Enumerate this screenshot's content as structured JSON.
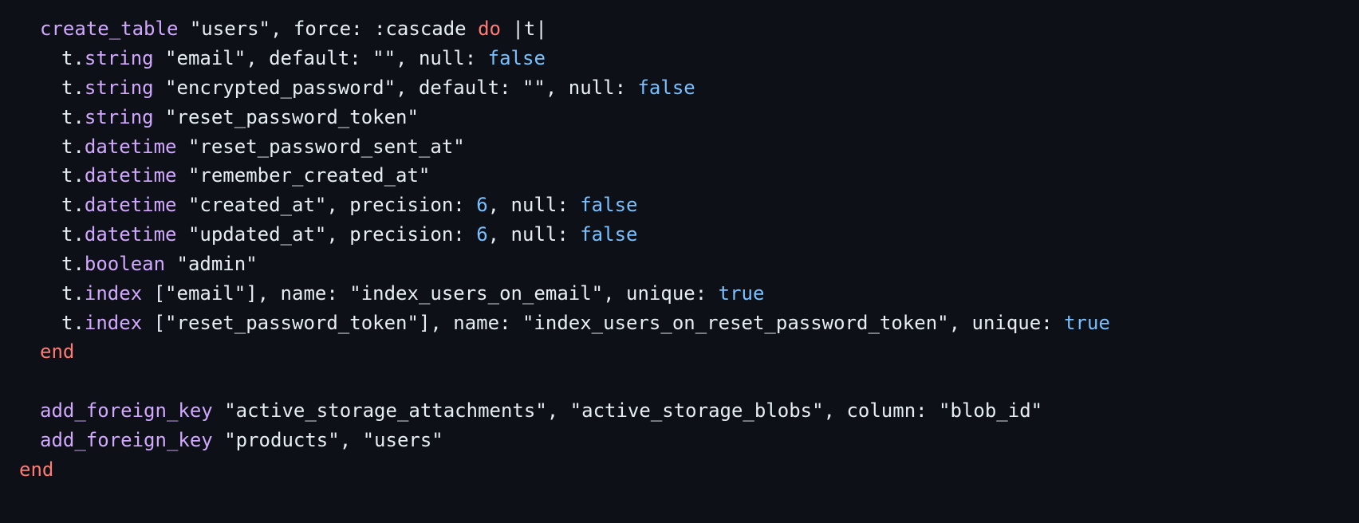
{
  "theme": {
    "background": "#0d1117",
    "text": "#e6edf3",
    "method": "#d2a8ff",
    "keyword": "#ff7b72",
    "constant": "#79c0ff"
  },
  "code": {
    "language": "ruby",
    "lines": [
      [
        [
          "fn",
          "create_table"
        ],
        [
          "plain",
          " \"users\", force: :cascade "
        ],
        [
          "kw",
          "do"
        ],
        [
          "plain",
          " |t|"
        ]
      ],
      [
        [
          "plain",
          "t."
        ],
        [
          "fn",
          "string"
        ],
        [
          "plain",
          " \"email\", default: \"\", null: "
        ],
        [
          "num",
          "false"
        ]
      ],
      [
        [
          "plain",
          "t."
        ],
        [
          "fn",
          "string"
        ],
        [
          "plain",
          " \"encrypted_password\", default: \"\", null: "
        ],
        [
          "num",
          "false"
        ]
      ],
      [
        [
          "plain",
          "t."
        ],
        [
          "fn",
          "string"
        ],
        [
          "plain",
          " \"reset_password_token\""
        ]
      ],
      [
        [
          "plain",
          "t."
        ],
        [
          "fn",
          "datetime"
        ],
        [
          "plain",
          " \"reset_password_sent_at\""
        ]
      ],
      [
        [
          "plain",
          "t."
        ],
        [
          "fn",
          "datetime"
        ],
        [
          "plain",
          " \"remember_created_at\""
        ]
      ],
      [
        [
          "plain",
          "t."
        ],
        [
          "fn",
          "datetime"
        ],
        [
          "plain",
          " \"created_at\", precision: "
        ],
        [
          "num",
          "6"
        ],
        [
          "plain",
          ", null: "
        ],
        [
          "num",
          "false"
        ]
      ],
      [
        [
          "plain",
          "t."
        ],
        [
          "fn",
          "datetime"
        ],
        [
          "plain",
          " \"updated_at\", precision: "
        ],
        [
          "num",
          "6"
        ],
        [
          "plain",
          ", null: "
        ],
        [
          "num",
          "false"
        ]
      ],
      [
        [
          "plain",
          "t."
        ],
        [
          "fn",
          "boolean"
        ],
        [
          "plain",
          " \"admin\""
        ]
      ],
      [
        [
          "plain",
          "t."
        ],
        [
          "fn",
          "index"
        ],
        [
          "plain",
          " [\"email\"], name: \"index_users_on_email\", unique: "
        ],
        [
          "num",
          "true"
        ]
      ],
      [
        [
          "plain",
          "t."
        ],
        [
          "fn",
          "index"
        ],
        [
          "plain",
          " [\"reset_password_token\"], name: \"index_users_on_reset_password_token\", unique: "
        ],
        [
          "num",
          "true"
        ]
      ],
      [
        [
          "kw",
          "end"
        ]
      ],
      [],
      [
        [
          "fn",
          "add_foreign_key"
        ],
        [
          "plain",
          " \"active_storage_attachments\", \"active_storage_blobs\", column: \"blob_id\""
        ]
      ],
      [
        [
          "fn",
          "add_foreign_key"
        ],
        [
          "plain",
          " \"products\", \"users\""
        ]
      ],
      [
        [
          "kw",
          "end"
        ]
      ]
    ]
  }
}
